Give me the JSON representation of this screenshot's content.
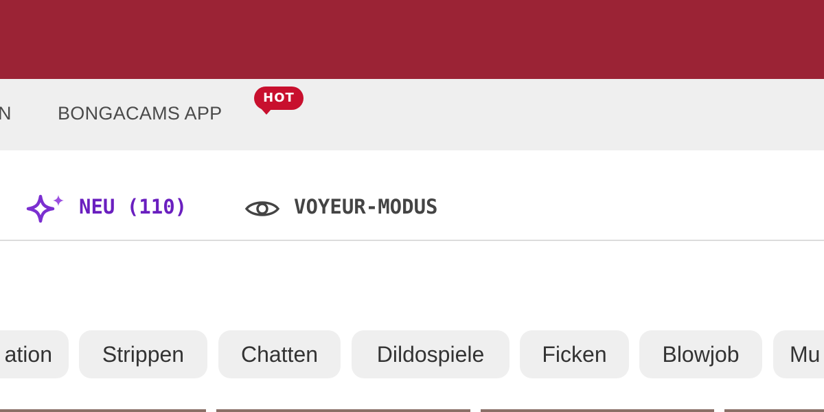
{
  "nav": {
    "partial_item": "N",
    "app_item": "BONGACAMS APP",
    "hot_badge": "HOT"
  },
  "filters": {
    "neu": "NEU (110)",
    "voyeur": "VOYEUR-MODUS"
  },
  "categories": [
    "ation",
    "Strippen",
    "Chatten",
    "Dildospiele",
    "Ficken",
    "Blowjob",
    "Mu"
  ],
  "icons": {
    "neu": "sparkle-icon",
    "voyeur": "eye-icon"
  },
  "colors": {
    "header": "#9b2335",
    "badge": "#c8102e",
    "accent_purple": "#6a1fbf"
  }
}
